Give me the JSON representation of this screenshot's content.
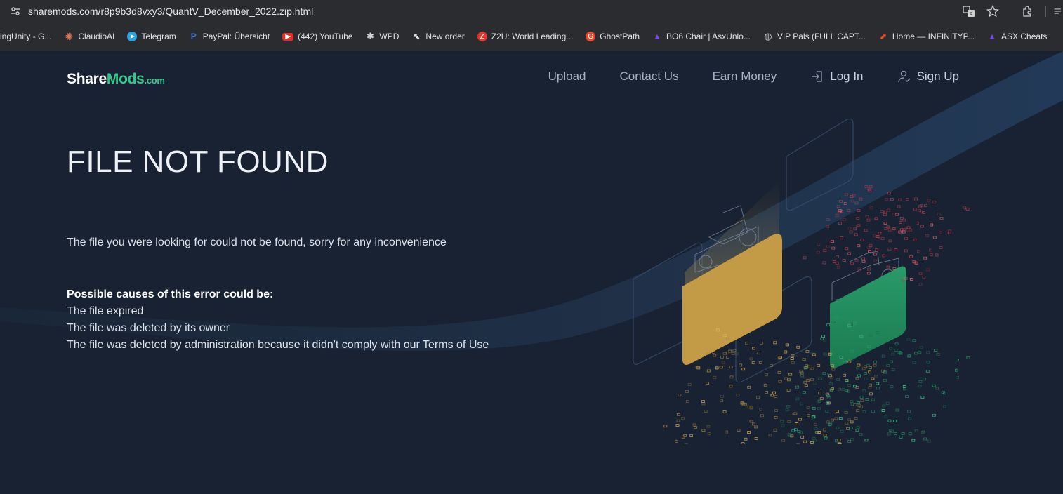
{
  "browser": {
    "url": "sharemods.com/r8p9b3d8vxy3/QuantV_December_2022.zip.html",
    "bookmarks": [
      {
        "label": "ingUnity - G...",
        "color": ""
      },
      {
        "label": "ClaudioAI",
        "color": "#d9775a"
      },
      {
        "label": "Telegram",
        "color": "#2aa3e0"
      },
      {
        "label": "PayPal: Übersicht",
        "color": "#1f5fbf"
      },
      {
        "label": "(442) YouTube",
        "color": "#e52d27"
      },
      {
        "label": "WPD",
        "color": "#888888"
      },
      {
        "label": "New order",
        "color": "#bbbbbb"
      },
      {
        "label": "Z2U: World Leading...",
        "color": "#e2362b"
      },
      {
        "label": "GhostPath",
        "color": "#e8472b"
      },
      {
        "label": "BO6 Chair | AsxUnlo...",
        "color": "#6a3fd0"
      },
      {
        "label": "VIP Pals (FULL CAPT...",
        "color": "#9a9a9a"
      },
      {
        "label": "Home — INFINITYP...",
        "color": "#e8472b"
      },
      {
        "label": "ASX Cheats",
        "color": "#6a3fd0"
      }
    ]
  },
  "header": {
    "logo_share": "Share",
    "logo_mods": "Mods",
    "logo_com": ".com",
    "nav": {
      "upload": "Upload",
      "contact": "Contact Us",
      "earn": "Earn Money",
      "login": "Log In",
      "signup": "Sign Up"
    }
  },
  "main": {
    "title": "FILE NOT FOUND",
    "message": "The file you were looking for could not be found, sorry for any inconvenience",
    "causes_heading": "Possible causes of this error could be:",
    "causes": [
      "The file expired",
      "The file was deleted by its owner",
      "The file was deleted by administration because it didn't comply with our Terms of Use"
    ]
  },
  "colors": {
    "background": "#182232",
    "accent_green": "#35c88a",
    "card_gold": "#c39a45",
    "card_green": "#1f8a5e"
  }
}
